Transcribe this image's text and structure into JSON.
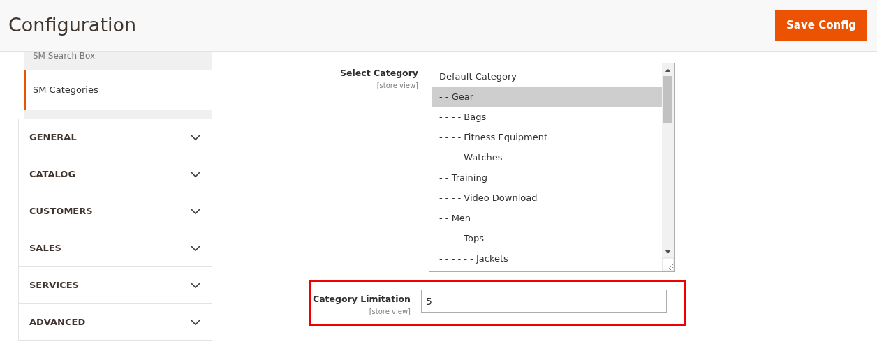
{
  "header": {
    "title": "Configuration",
    "save_button": "Save Config"
  },
  "sidebar": {
    "sub_items": [
      {
        "label": "SM Search Box",
        "selected": false
      },
      {
        "label": "SM Categories",
        "selected": true
      }
    ],
    "sections": [
      {
        "label": "GENERAL",
        "expanded": false
      },
      {
        "label": "CATALOG",
        "expanded": false
      },
      {
        "label": "CUSTOMERS",
        "expanded": false
      },
      {
        "label": "SALES",
        "expanded": false
      },
      {
        "label": "SERVICES",
        "expanded": false
      },
      {
        "label": "ADVANCED",
        "expanded": false
      }
    ]
  },
  "fields": [
    {
      "kind": "multiselect",
      "label": "Select Category",
      "scope": "[store view]",
      "highlighted": false,
      "options": [
        {
          "label": "Default Category",
          "selected": false
        },
        {
          "label": "- - Gear",
          "selected": true
        },
        {
          "label": "- - - - Bags",
          "selected": false
        },
        {
          "label": "- - - - Fitness Equipment",
          "selected": false
        },
        {
          "label": "- - - - Watches",
          "selected": false
        },
        {
          "label": "- - Training",
          "selected": false
        },
        {
          "label": "- - - - Video Download",
          "selected": false
        },
        {
          "label": "- - Men",
          "selected": false
        },
        {
          "label": "- - - - Tops",
          "selected": false
        },
        {
          "label": "- - - - - - Jackets",
          "selected": false
        }
      ]
    },
    {
      "kind": "text",
      "label": "Category Limitation",
      "scope": "[store view]",
      "highlighted": true,
      "value": "5"
    }
  ]
}
